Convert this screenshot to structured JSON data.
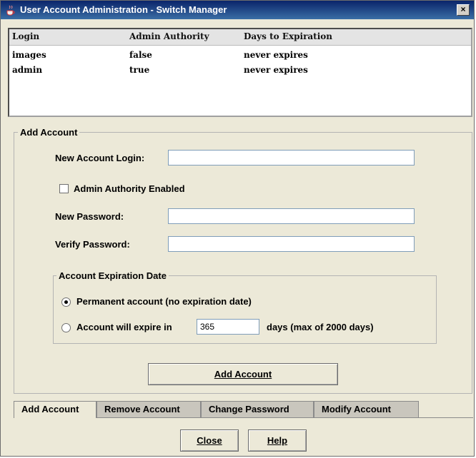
{
  "window": {
    "title": "User Account Administration - Switch Manager",
    "close_glyph": "×"
  },
  "table": {
    "headers": [
      "Login",
      "Admin Authority",
      "Days to Expiration"
    ],
    "rows": [
      [
        "images",
        "false",
        "never expires"
      ],
      [
        "admin",
        "true",
        "never expires"
      ]
    ]
  },
  "add_account": {
    "group_title": "Add Account",
    "login_label": "New Account Login:",
    "login_value": "",
    "admin_checkbox_label": "Admin Authority Enabled",
    "admin_checked": false,
    "password_label": "New Password:",
    "password_value": "",
    "verify_label": "Verify Password:",
    "verify_value": "",
    "expiration": {
      "group_title": "Account Expiration Date",
      "permanent_label": "Permanent account (no expiration date)",
      "expire_label": "Account will expire in",
      "days_value": "365",
      "days_suffix": "days (max of 2000 days)",
      "selected": "permanent"
    },
    "submit_label": "Add Account"
  },
  "tabs": [
    {
      "label": "Add Account",
      "active": true
    },
    {
      "label": "Remove Account",
      "active": false
    },
    {
      "label": "Change Password",
      "active": false
    },
    {
      "label": "Modify Account",
      "active": false
    }
  ],
  "footer": {
    "close_label": "Close",
    "help_label": "Help"
  },
  "colors": {
    "titlebar": "#0a246a",
    "window_bg": "#ece9d8",
    "input_border": "#7f9db9"
  }
}
